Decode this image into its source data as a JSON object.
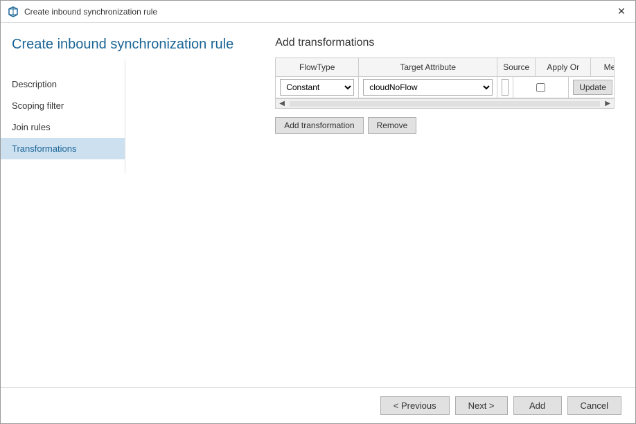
{
  "window": {
    "title": "Create inbound synchronization rule",
    "close_label": "✕"
  },
  "page_title": "Create inbound synchronization rule",
  "sidebar": {
    "items": [
      {
        "label": "Description",
        "active": false
      },
      {
        "label": "Scoping filter",
        "active": false
      },
      {
        "label": "Join rules",
        "active": false
      },
      {
        "label": "Transformations",
        "active": true
      }
    ]
  },
  "main": {
    "section_title": "Add transformations",
    "table": {
      "headers": [
        "FlowType",
        "Target Attribute",
        "Source",
        "Apply Or",
        "Merge Type"
      ],
      "row": {
        "flowtype": "Constant",
        "target_attribute": "cloudNoFlow",
        "source": "True",
        "apply_once": false,
        "merge_type": "Update"
      }
    },
    "buttons": {
      "add_transformation": "Add transformation",
      "remove": "Remove"
    }
  },
  "footer": {
    "previous": "< Previous",
    "next": "Next >",
    "add": "Add",
    "cancel": "Cancel"
  },
  "icons": {
    "app_icon": "⚙"
  }
}
